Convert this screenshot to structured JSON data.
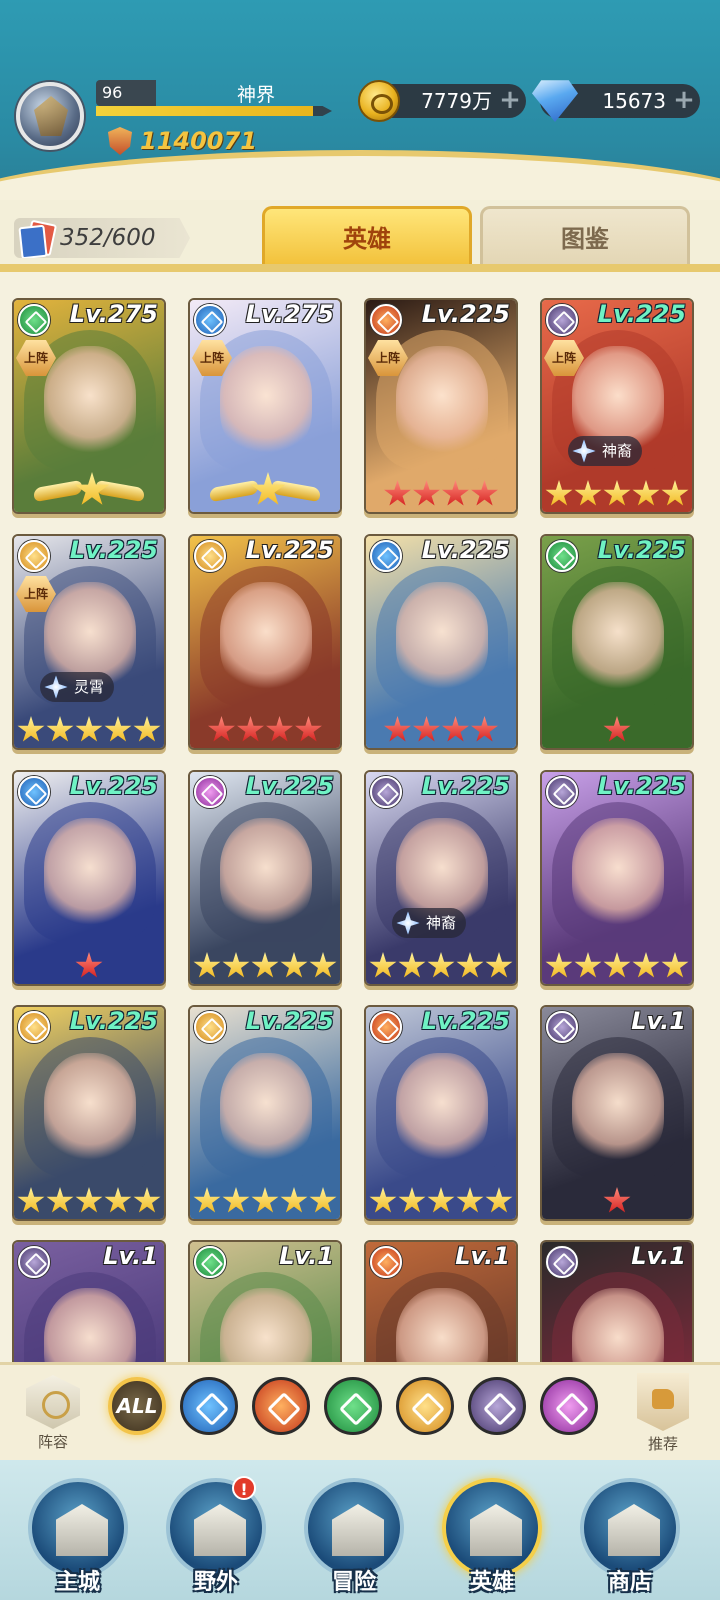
{
  "header": {
    "player_level": "96",
    "player_name": "神界",
    "xp_fraction": 0.92,
    "power": "1140071",
    "gold": "7779万",
    "gems": "15673",
    "plus_symbol": "+"
  },
  "tabs": {
    "card_count": "352/600",
    "heroes": "英雄",
    "codex": "图鉴"
  },
  "deployed_label": "上阵",
  "heroes": [
    {
      "level": "Lv.275",
      "faction": "wood",
      "deployed": true,
      "tag": "",
      "stars": 1,
      "star_type": "wing",
      "lv_color": "white",
      "palette": [
        "#5a7d3a",
        "#e3b33d"
      ]
    },
    {
      "level": "Lv.275",
      "faction": "water",
      "deployed": true,
      "tag": "",
      "stars": 1,
      "star_type": "wing",
      "lv_color": "white",
      "palette": [
        "#8aa0d8",
        "#f3eaf6"
      ]
    },
    {
      "level": "Lv.225",
      "faction": "fire",
      "deployed": true,
      "tag": "",
      "stars": 4,
      "star_type": "red",
      "lv_color": "white",
      "palette": [
        "#e0a96a",
        "#2a1a14"
      ]
    },
    {
      "level": "Lv.225",
      "faction": "dark",
      "deployed": true,
      "tag": "神裔",
      "stars": 5,
      "star_type": "gold",
      "lv_color": "green",
      "palette": [
        "#b03a2a",
        "#e86a4a"
      ]
    },
    {
      "level": "Lv.225",
      "faction": "light",
      "deployed": true,
      "tag": "灵霄",
      "stars": 5,
      "star_type": "gold",
      "lv_color": "green",
      "palette": [
        "#3a4a7a",
        "#e6e6ea"
      ]
    },
    {
      "level": "Lv.225",
      "faction": "light",
      "deployed": false,
      "tag": "",
      "stars": 4,
      "star_type": "red",
      "lv_color": "white",
      "palette": [
        "#8a3a2a",
        "#f2c24a"
      ]
    },
    {
      "level": "Lv.225",
      "faction": "water",
      "deployed": false,
      "tag": "",
      "stars": 4,
      "star_type": "red",
      "lv_color": "white",
      "palette": [
        "#4a7ab0",
        "#f4e0a8"
      ]
    },
    {
      "level": "Lv.225",
      "faction": "wood",
      "deployed": false,
      "tag": "",
      "stars": 1,
      "star_type": "red",
      "lv_color": "green",
      "palette": [
        "#3a6a2a",
        "#7aa04a"
      ]
    },
    {
      "level": "Lv.225",
      "faction": "water",
      "deployed": false,
      "tag": "",
      "stars": 1,
      "star_type": "red",
      "lv_color": "green",
      "palette": [
        "#2a3a8a",
        "#f0f0f0"
      ]
    },
    {
      "level": "Lv.225",
      "faction": "chaos",
      "deployed": false,
      "tag": "",
      "stars": 5,
      "star_type": "gold",
      "lv_color": "green",
      "palette": [
        "#3a4660",
        "#dfe6f0"
      ]
    },
    {
      "level": "Lv.225",
      "faction": "dark",
      "deployed": false,
      "tag": "神裔",
      "stars": 5,
      "star_type": "gold",
      "lv_color": "green",
      "palette": [
        "#3a3a6a",
        "#d8d8f0"
      ]
    },
    {
      "level": "Lv.225",
      "faction": "dark",
      "deployed": false,
      "tag": "",
      "stars": 5,
      "star_type": "gold",
      "lv_color": "green",
      "palette": [
        "#5a3a7a",
        "#c8a0e8"
      ]
    },
    {
      "level": "Lv.225",
      "faction": "light",
      "deployed": false,
      "tag": "",
      "stars": 5,
      "star_type": "gold",
      "lv_color": "green",
      "palette": [
        "#3a4a6a",
        "#f0d060"
      ]
    },
    {
      "level": "Lv.225",
      "faction": "light",
      "deployed": false,
      "tag": "",
      "stars": 5,
      "star_type": "gold",
      "lv_color": "green",
      "palette": [
        "#3a6aa0",
        "#e8e0d0"
      ]
    },
    {
      "level": "Lv.225",
      "faction": "fire",
      "deployed": false,
      "tag": "",
      "stars": 5,
      "star_type": "gold",
      "lv_color": "green",
      "palette": [
        "#3a4a8a",
        "#c0c8d8"
      ]
    },
    {
      "level": "Lv.1",
      "faction": "dark",
      "deployed": false,
      "tag": "",
      "stars": 1,
      "star_type": "red",
      "lv_color": "white",
      "palette": [
        "#2a2a3a",
        "#8a8a9a"
      ]
    },
    {
      "level": "Lv.1",
      "faction": "dark",
      "deployed": false,
      "tag": "",
      "stars": 0,
      "star_type": "red",
      "lv_color": "white",
      "palette": [
        "#4a3a7a",
        "#7a60a0"
      ]
    },
    {
      "level": "Lv.1",
      "faction": "wood",
      "deployed": false,
      "tag": "",
      "stars": 0,
      "star_type": "red",
      "lv_color": "white",
      "palette": [
        "#5a8a4a",
        "#d0c090"
      ]
    },
    {
      "level": "Lv.1",
      "faction": "fire",
      "deployed": false,
      "tag": "",
      "stars": 0,
      "star_type": "red",
      "lv_color": "white",
      "palette": [
        "#6a3a2a",
        "#c06a3a"
      ]
    },
    {
      "level": "Lv.1",
      "faction": "dark",
      "deployed": false,
      "tag": "",
      "stars": 0,
      "star_type": "red",
      "lv_color": "white",
      "palette": [
        "#7a2a3a",
        "#2a2a2a"
      ]
    }
  ],
  "filters": {
    "lineup": "阵容",
    "all": "ALL",
    "factions": [
      "water",
      "fire",
      "wood",
      "light",
      "dark",
      "chaos"
    ],
    "recommend": "推荐"
  },
  "nav": [
    {
      "label": "主城",
      "icon": "castle-icon",
      "active": false,
      "badge": ""
    },
    {
      "label": "野外",
      "icon": "portal-icon",
      "active": false,
      "badge": "!"
    },
    {
      "label": "冒险",
      "icon": "sword-icon",
      "active": false,
      "badge": ""
    },
    {
      "label": "英雄",
      "icon": "helmet-icon",
      "active": true,
      "badge": ""
    },
    {
      "label": "商店",
      "icon": "shop-icon",
      "active": false,
      "badge": ""
    }
  ]
}
